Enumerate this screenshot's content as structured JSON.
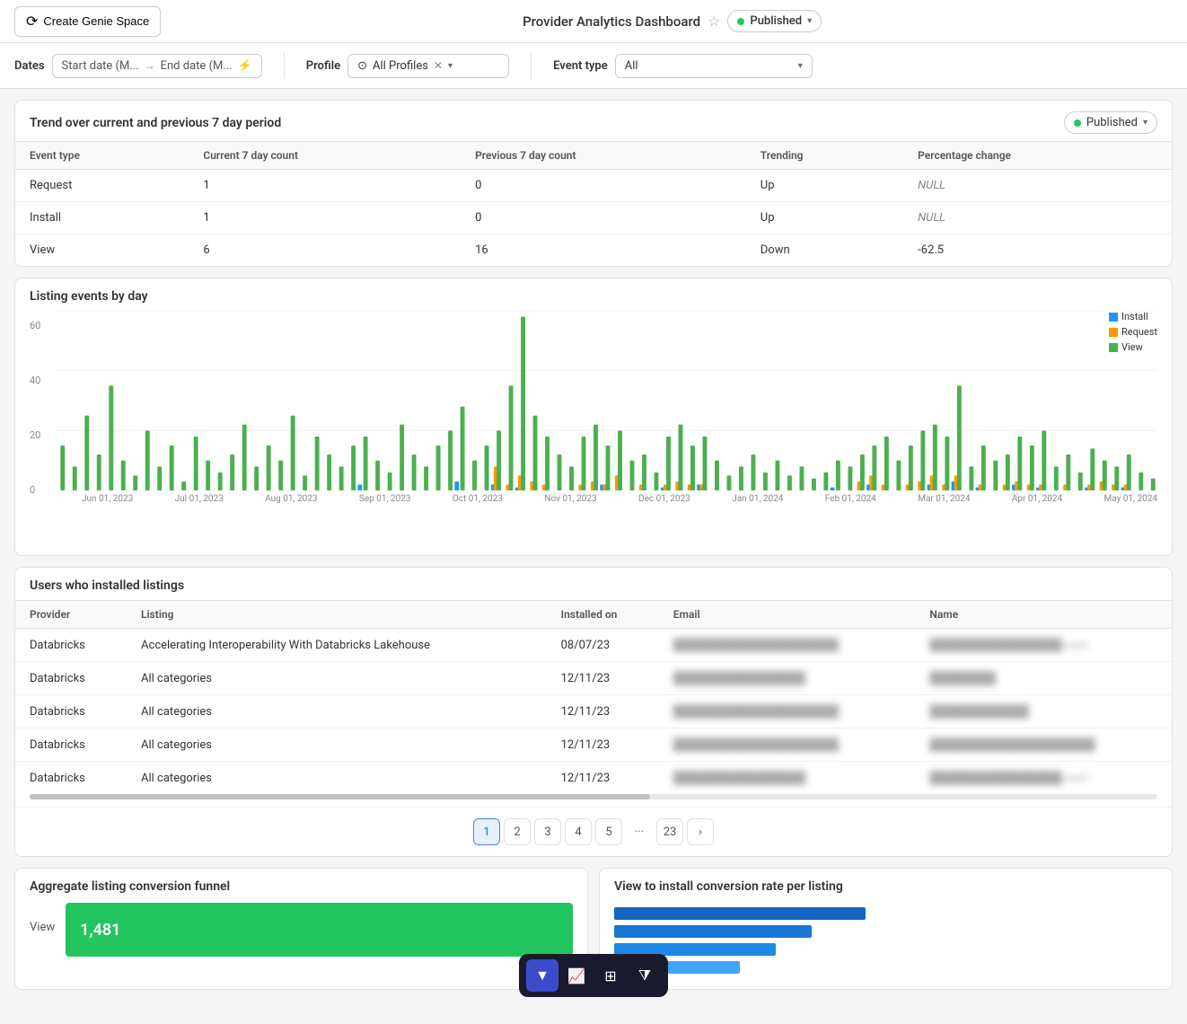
{
  "header": {
    "create_btn": "Create Genie Space",
    "title": "Provider Analytics Dashboard",
    "published_label": "Published"
  },
  "filters": {
    "dates_label": "Dates",
    "start_date_placeholder": "Start date (M...",
    "end_date_placeholder": "End date (M...",
    "profile_label": "Profile",
    "all_profiles": "All Profiles",
    "event_type_label": "Event type",
    "event_type_value": "All"
  },
  "trend_section": {
    "title": "Trend over current and previous 7 day period",
    "published_badge": "Published",
    "columns": [
      "Event type",
      "Current 7 day count",
      "Previous 7 day count",
      "Trending",
      "Percentage change"
    ],
    "rows": [
      {
        "event_type": "Request",
        "current": "1",
        "previous": "0",
        "trending": "Up",
        "percentage": "NULL"
      },
      {
        "event_type": "Install",
        "current": "1",
        "previous": "0",
        "trending": "Up",
        "percentage": "NULL"
      },
      {
        "event_type": "View",
        "current": "6",
        "previous": "16",
        "trending": "Down",
        "percentage": "-62.5"
      }
    ]
  },
  "chart_section": {
    "title": "Listing events by day",
    "legend": [
      {
        "label": "Install",
        "color": "#2196F3"
      },
      {
        "label": "Request",
        "color": "#FF9800"
      },
      {
        "label": "View",
        "color": "#4CAF50"
      }
    ],
    "y_labels": [
      "0",
      "20",
      "40",
      "60"
    ],
    "x_labels": [
      "Jun 01, 2023",
      "Jul 01, 2023",
      "Aug 01, 2023",
      "Sep 01, 2023",
      "Oct 01, 2023",
      "Nov 01, 2023",
      "Dec 01, 2023",
      "Jan 01, 2024",
      "Feb 01, 2024",
      "Mar 01, 2024",
      "Apr 01, 2024",
      "May 01, 2024"
    ]
  },
  "users_section": {
    "title": "Users who installed listings",
    "columns": [
      "Provider",
      "Listing",
      "Installed on",
      "Email",
      "Name"
    ],
    "rows": [
      {
        "provider": "Databricks",
        "listing": "Accelerating Interoperability With Databricks Lakehouse",
        "installed_on": "08/07/23",
        "email": "████████████████████",
        "name": "████████████████.com"
      },
      {
        "provider": "Databricks",
        "listing": "All categories",
        "installed_on": "12/11/23",
        "email": "████████████████",
        "name": "████████"
      },
      {
        "provider": "Databricks",
        "listing": "All categories",
        "installed_on": "12/11/23",
        "email": "████████████████████",
        "name": "████████████"
      },
      {
        "provider": "Databricks",
        "listing": "All categories",
        "installed_on": "12/11/23",
        "email": "████████████████████",
        "name": "████████████████████"
      },
      {
        "provider": "Databricks",
        "listing": "All categories",
        "installed_on": "12/11/23",
        "email": "████████████████",
        "name": "████████████████.com"
      }
    ]
  },
  "pagination": {
    "pages": [
      "1",
      "2",
      "3",
      "4",
      "5",
      "...",
      "23"
    ],
    "active": "1"
  },
  "funnel_section": {
    "title": "Aggregate listing conversion funnel",
    "view_label": "View",
    "view_value": "1,481"
  },
  "conversion_section": {
    "title": "View to install conversion rate per listing"
  },
  "toolbar": {
    "buttons": [
      "filter",
      "chart",
      "grid",
      "funnel"
    ]
  }
}
